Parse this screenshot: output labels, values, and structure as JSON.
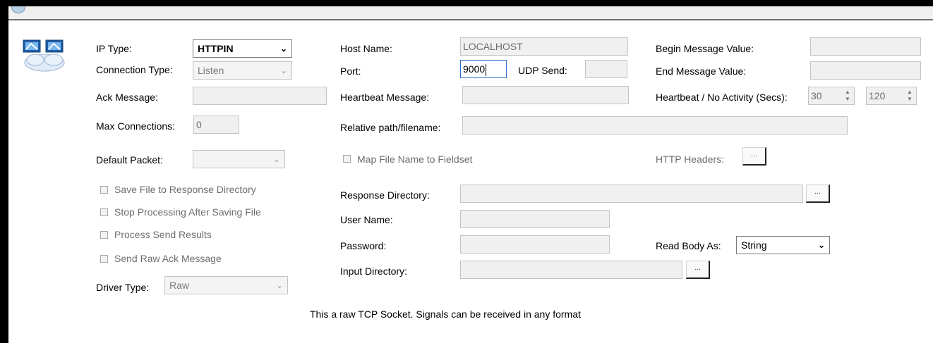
{
  "connection_icon": "network-computers-cloud-icon",
  "ip_type": {
    "label": "IP Type:",
    "value": "HTTPIN"
  },
  "connection_type": {
    "label": "Connection Type:",
    "value": "Listen"
  },
  "ack_message": {
    "label": "Ack Message:",
    "value": ""
  },
  "max_connections": {
    "label": "Max Connections:",
    "value": "0"
  },
  "default_packet": {
    "label": "Default Packet:",
    "value": ""
  },
  "checkboxes": [
    {
      "label": "Save File to Response Directory",
      "checked": false
    },
    {
      "label": "Stop Processing After Saving File",
      "checked": false
    },
    {
      "label": "Process Send Results",
      "checked": false
    },
    {
      "label": "Send Raw Ack Message",
      "checked": false
    }
  ],
  "driver_type": {
    "label": "Driver Type:",
    "value": "Raw"
  },
  "host_name": {
    "label": "Host Name:",
    "value": "LOCALHOST"
  },
  "port": {
    "label": "Port:",
    "value": "9000"
  },
  "udp_send": {
    "label": "UDP Send:",
    "value": ""
  },
  "heartbeat_message": {
    "label": "Heartbeat  Message:",
    "value": ""
  },
  "relative_path": {
    "label": "Relative path/filename:",
    "value": ""
  },
  "map_file_name": {
    "label": "Map File Name to Fieldset",
    "checked": false
  },
  "response_directory": {
    "label": "Response Directory:",
    "value": "",
    "browse": "..."
  },
  "user_name": {
    "label": "User Name:",
    "value": ""
  },
  "password": {
    "label": "Password:",
    "value": ""
  },
  "input_directory": {
    "label": "Input Directory:",
    "value": "",
    "browse": "..."
  },
  "begin_message_value": {
    "label": "Begin Message Value:",
    "value": ""
  },
  "end_message_value": {
    "label": "End Message Value:",
    "value": ""
  },
  "heartbeat_no_activity": {
    "label": "Heartbeat / No Activity (Secs):",
    "heartbeat_secs": "30",
    "no_activity_secs": "120"
  },
  "http_headers": {
    "label": "HTTP Headers:",
    "browse": "..."
  },
  "read_body_as": {
    "label": "Read Body As:",
    "value": "String"
  },
  "footer_note": "This a raw TCP Socket. Signals can be received in any format"
}
